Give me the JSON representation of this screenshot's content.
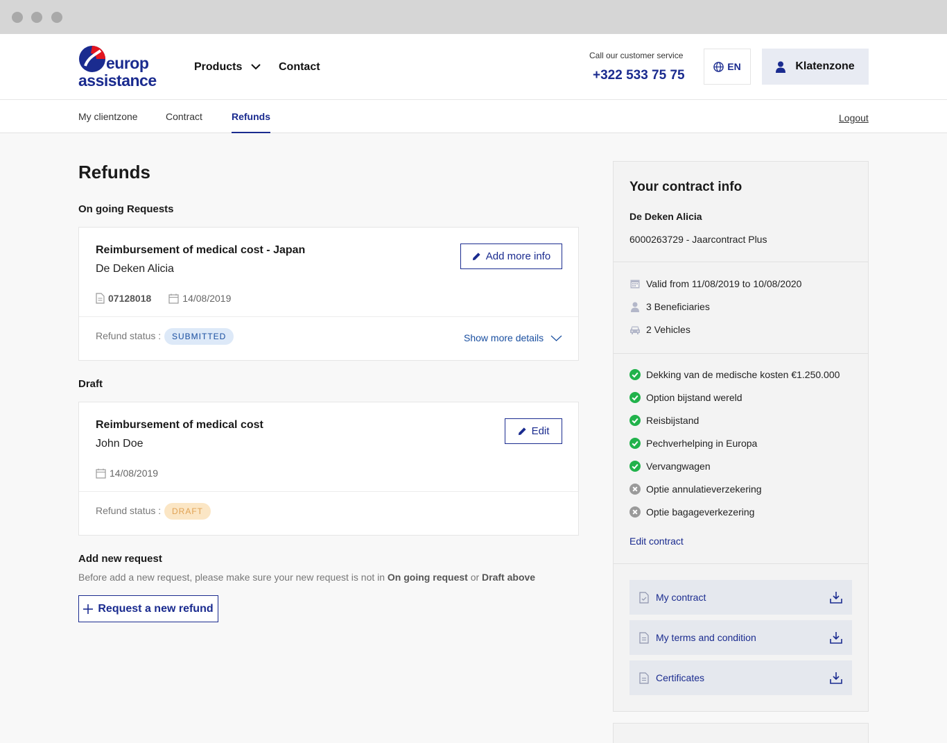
{
  "header": {
    "logo_line1": "europ",
    "logo_line2": "assistance",
    "nav": [
      {
        "label": "Products"
      },
      {
        "label": "Contact"
      }
    ],
    "service_label": "Call our customer service",
    "service_phone": "+322 533 75 75",
    "language": "EN",
    "client_zone_button": "Klatenzone"
  },
  "subnav": {
    "tabs": [
      {
        "label": "My clientzone"
      },
      {
        "label": "Contract"
      },
      {
        "label": "Refunds",
        "active": true
      }
    ],
    "logout": "Logout"
  },
  "main": {
    "title": "Refunds",
    "ongoing": {
      "section_title": "On going Requests",
      "card": {
        "title": "Reimbursement of medical cost - Japan",
        "person": "De Deken Alicia",
        "reference": "07128018",
        "date": "14/08/2019",
        "action_label": "Add more info",
        "status_label": "Refund status :",
        "status": "SUBMITTED",
        "details_link": "Show more details"
      }
    },
    "draft": {
      "section_title": "Draft",
      "card": {
        "title": "Reimbursement of medical cost",
        "person": "John Doe",
        "date": "14/08/2019",
        "action_label": "Edit",
        "status_label": "Refund status :",
        "status": "DRAFT"
      }
    },
    "add_new": {
      "title": "Add new request",
      "desc_prefix": "Before add a new request, please make sure your new request is not in ",
      "desc_bold1": "On going request",
      "desc_or": " or ",
      "desc_bold2": "Draft above",
      "button_label": "Request a new refund"
    }
  },
  "sidebar": {
    "title": "Your contract info",
    "holder": "De Deken Alicia",
    "contract": "6000263729 - Jaarcontract Plus",
    "details": [
      {
        "icon": "calendar-icon",
        "text": "Valid from 11/08/2019 to 10/08/2020"
      },
      {
        "icon": "person-icon",
        "text": "3 Beneficiaries"
      },
      {
        "icon": "car-icon",
        "text": "2 Vehicles"
      }
    ],
    "coverages": [
      {
        "text": "Dekking van de medische kosten €1.250.000",
        "included": true
      },
      {
        "text": "Option bijstand wereld",
        "included": true
      },
      {
        "text": "Reisbijstand",
        "included": true
      },
      {
        "text": "Pechverhelping in Europa",
        "included": true
      },
      {
        "text": "Vervangwagen",
        "included": true
      },
      {
        "text": "Optie annulatieverzekering",
        "included": false
      },
      {
        "text": "Optie bagageverkezering",
        "included": false
      }
    ],
    "edit_link": "Edit contract",
    "documents": [
      {
        "label": "My contract"
      },
      {
        "label": "My terms and condition"
      },
      {
        "label": "Certificates"
      }
    ]
  },
  "colors": {
    "brand_blue": "#1a2b8f",
    "brand_red": "#e3151f",
    "check_green": "#21b24b",
    "cross_gray": "#9a9a9a"
  }
}
